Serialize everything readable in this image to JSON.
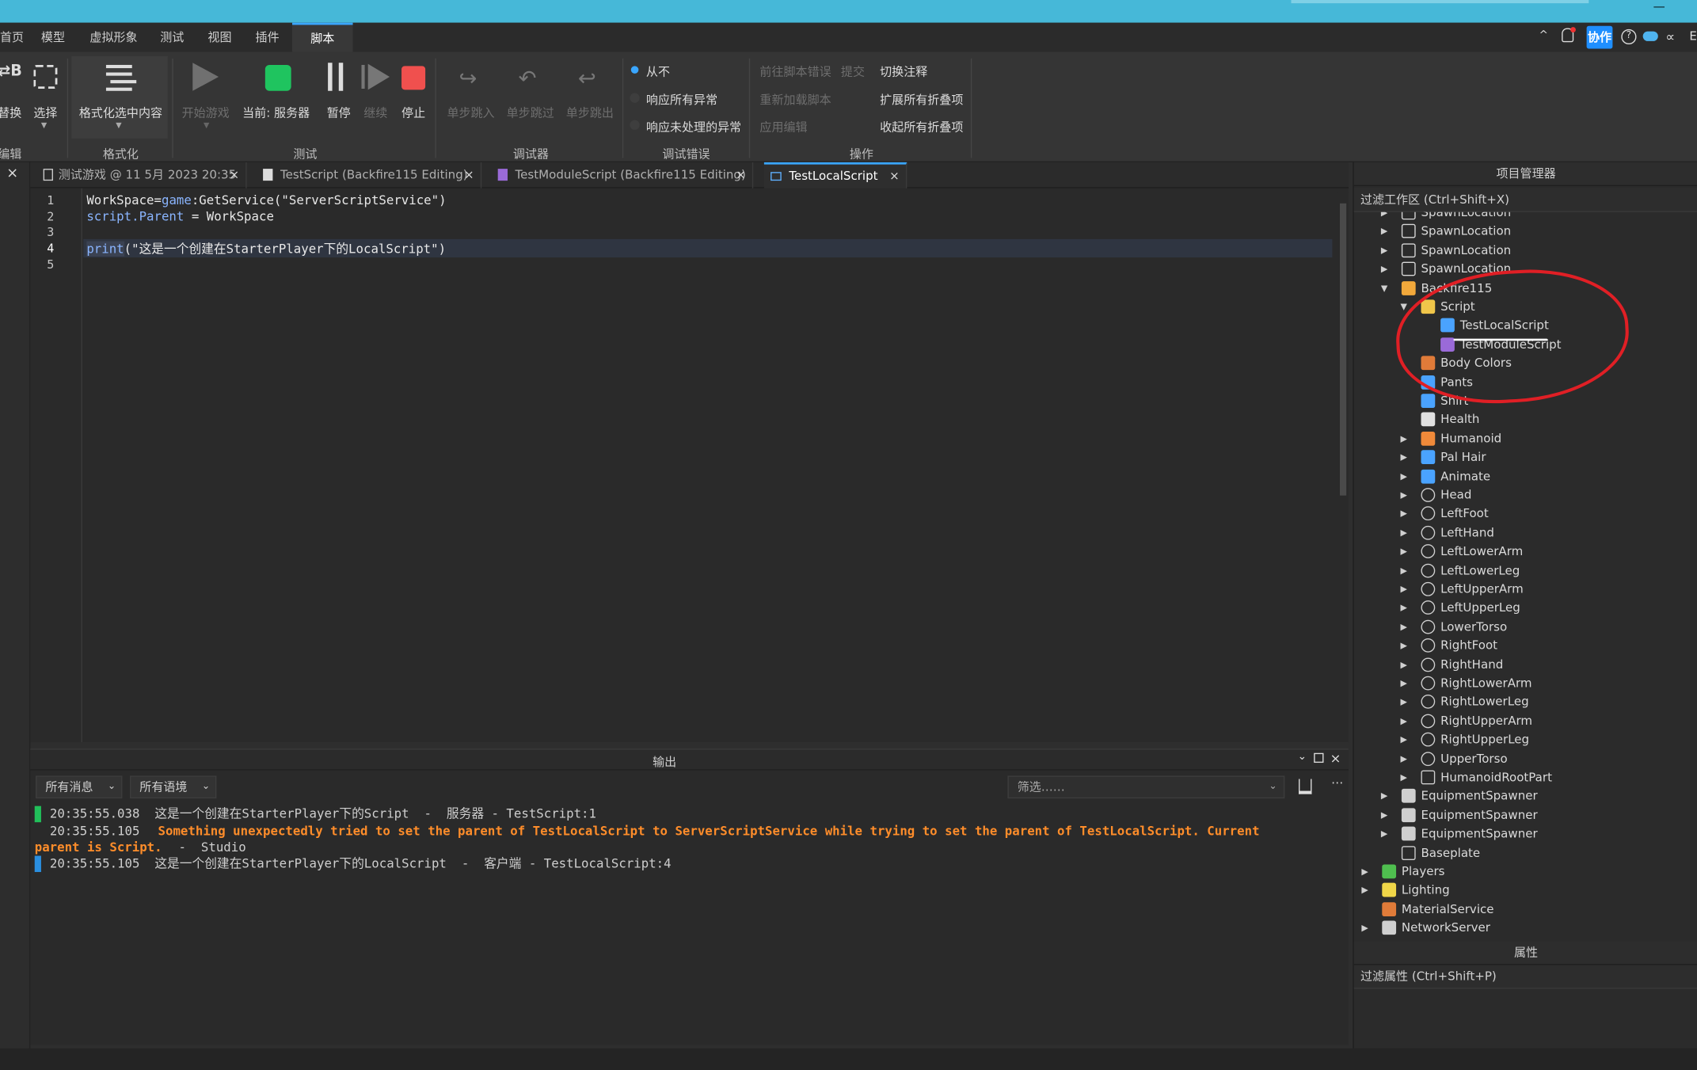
{
  "menu": [
    "首页",
    "模型",
    "虚拟形象",
    "测试",
    "视图",
    "插件",
    "脚本"
  ],
  "ribbon": {
    "replace": "替换",
    "select": "选择",
    "format_selection": "格式化选中内容",
    "format_group": "格式化",
    "edit_group": "编辑",
    "start_game": "开始游戏",
    "current_server": "当前: 服务器",
    "pause": "暂停",
    "resume": "继续",
    "stop": "停止",
    "test_group": "测试",
    "step_into": "单步跳入",
    "step_over": "单步跳过",
    "step_out": "单步跳出",
    "debugger_group": "调试器",
    "never": "从不",
    "all_exceptions": "响应所有异常",
    "unhandled_exceptions": "响应未处理的异常",
    "debug_errors_group": "调试错误",
    "goto_script_error": "前往脚本错误",
    "commit": "提交",
    "reload_script": "重新加载脚本",
    "apply_edit": "应用编辑",
    "toggle_comment": "切换注释",
    "expand_all_folds": "扩展所有折叠项",
    "collapse_all_folds": "收起所有折叠项",
    "actions_group": "操作"
  },
  "topbar": {
    "collab": "协作"
  },
  "tabs": [
    {
      "label": "测试游戏 @ 11 5月 2023 20:35"
    },
    {
      "label": "TestScript (Backfire115 Editing)"
    },
    {
      "label": "TestModuleScript (Backfire115 Editing)"
    },
    {
      "label": "TestLocalScript"
    }
  ],
  "editor": {
    "line_numbers": [
      "1",
      "2",
      "3",
      "4",
      "5"
    ],
    "line1_a": "WorkSpace=",
    "line1_b": "game",
    "line1_c": ":GetService(\"ServerScriptService\")",
    "line2_a": "script",
    "line2_b": ".Parent",
    "line2_c": " = WorkSpace",
    "line4_a": "print",
    "line4_b": "(\"这是一个创建在StarterPlayer下的LocalScript\")"
  },
  "output": {
    "title": "输出",
    "filter_messages": "所有消息",
    "filter_contexts": "所有语境",
    "search_placeholder": "筛选……",
    "lines": [
      "20:35:55.038  这是一个创建在StarterPlayer下的Script  -  服务器 - TestScript:1",
      "20:35:55.105",
      "Something unexpectedly tried to set the parent of TestLocalScript to ServerScriptService while trying to set the parent of TestLocalScript. Current",
      "parent is Script.",
      "-  Studio",
      "20:35:55.105  这是一个创建在StarterPlayer下的LocalScript  -  客户端 - TestLocalScript:4"
    ]
  },
  "explorer": {
    "title": "项目管理器",
    "filter": "过滤工作区 (Ctrl+Shift+X)",
    "items": [
      {
        "label": "SpawnLocation",
        "icon": "spawn-icon"
      },
      {
        "label": "SpawnLocation",
        "icon": "spawn-icon"
      },
      {
        "label": "SpawnLocation",
        "icon": "spawn-icon"
      },
      {
        "label": "SpawnLocation",
        "icon": "spawn-icon"
      },
      {
        "label": "Backfire115",
        "icon": "model-icon"
      },
      {
        "label": "Script",
        "icon": "folder-icon"
      },
      {
        "label": "TestLocalScript",
        "icon": "local-script-icon"
      },
      {
        "label": "TestModuleScript",
        "icon": "module-script-icon"
      },
      {
        "label": "Body Colors",
        "icon": "body-colors-icon"
      },
      {
        "label": "Pants",
        "icon": "pants-icon"
      },
      {
        "label": "Shirt",
        "icon": "shirt-icon"
      },
      {
        "label": "Health",
        "icon": "script-icon"
      },
      {
        "label": "Humanoid",
        "icon": "humanoid-icon"
      },
      {
        "label": "Pal Hair",
        "icon": "hair-icon"
      },
      {
        "label": "Animate",
        "icon": "local-script-icon"
      },
      {
        "label": "Head",
        "icon": "part-icon"
      },
      {
        "label": "LeftFoot",
        "icon": "part-icon"
      },
      {
        "label": "LeftHand",
        "icon": "part-icon"
      },
      {
        "label": "LeftLowerArm",
        "icon": "part-icon"
      },
      {
        "label": "LeftLowerLeg",
        "icon": "part-icon"
      },
      {
        "label": "LeftUpperArm",
        "icon": "part-icon"
      },
      {
        "label": "LeftUpperLeg",
        "icon": "part-icon"
      },
      {
        "label": "LowerTorso",
        "icon": "part-icon"
      },
      {
        "label": "RightFoot",
        "icon": "part-icon"
      },
      {
        "label": "RightHand",
        "icon": "part-icon"
      },
      {
        "label": "RightLowerArm",
        "icon": "part-icon"
      },
      {
        "label": "RightLowerLeg",
        "icon": "part-icon"
      },
      {
        "label": "RightUpperArm",
        "icon": "part-icon"
      },
      {
        "label": "RightUpperLeg",
        "icon": "part-icon"
      },
      {
        "label": "UpperTorso",
        "icon": "part-icon"
      },
      {
        "label": "HumanoidRootPart",
        "icon": "block-icon"
      },
      {
        "label": "EquipmentSpawner",
        "icon": "spawner-icon"
      },
      {
        "label": "EquipmentSpawner",
        "icon": "spawner-icon"
      },
      {
        "label": "EquipmentSpawner",
        "icon": "spawner-icon"
      },
      {
        "label": "Baseplate",
        "icon": "block-icon"
      },
      {
        "label": "Players",
        "icon": "players-icon"
      },
      {
        "label": "Lighting",
        "icon": "lighting-icon"
      },
      {
        "label": "MaterialService",
        "icon": "material-icon"
      },
      {
        "label": "NetworkServer",
        "icon": "network-icon"
      }
    ]
  },
  "properties": {
    "title": "属性",
    "filter": "过滤属性 (Ctrl+Shift+P)"
  },
  "colors": {
    "accent": "#3aa6ff",
    "topbar": "#46b8d8",
    "warning": "#ff8d2a",
    "annotation": "#e01f25"
  }
}
